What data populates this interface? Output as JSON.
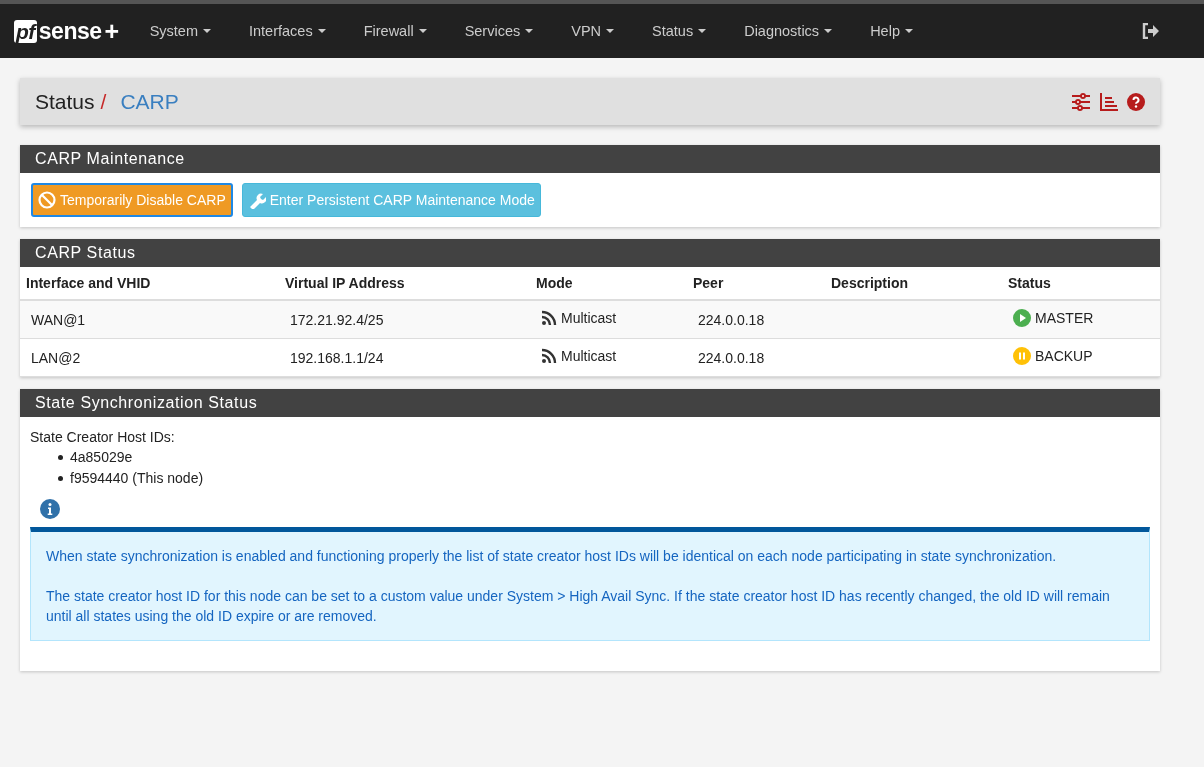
{
  "logo": {
    "box": "pf",
    "word": "sense",
    "plus": "+"
  },
  "nav": [
    {
      "label": "System"
    },
    {
      "label": "Interfaces"
    },
    {
      "label": "Firewall"
    },
    {
      "label": "Services"
    },
    {
      "label": "VPN"
    },
    {
      "label": "Status"
    },
    {
      "label": "Diagnostics"
    },
    {
      "label": "Help"
    }
  ],
  "breadcrumb": {
    "parent": "Status",
    "separator": "/",
    "current": "CARP"
  },
  "maintenance": {
    "title": "CARP Maintenance",
    "buttons": [
      {
        "kind": "disable",
        "label": "Temporarily Disable CARP"
      },
      {
        "kind": "persistent",
        "label": "Enter Persistent CARP Maintenance Mode"
      }
    ]
  },
  "carp_status": {
    "title": "CARP Status",
    "columns": [
      "Interface and VHID",
      "Virtual IP Address",
      "Mode",
      "Peer",
      "Description",
      "Status"
    ],
    "rows": [
      {
        "interface": "WAN@1",
        "vip": "172.21.92.4/25",
        "mode": "Multicast",
        "peer": "224.0.0.18",
        "status": {
          "kind": "master",
          "label": "MASTER"
        }
      },
      {
        "interface": "LAN@2",
        "vip": "192.168.1.1/24",
        "mode": "Multicast",
        "peer": "224.0.0.18",
        "status": {
          "kind": "backup",
          "label": "BACKUP"
        }
      }
    ]
  },
  "sync": {
    "title": "State Synchronization Status",
    "label": "State Creator Host IDs:",
    "ids": [
      "4a85029e",
      "f9594440 (This node)"
    ],
    "info": [
      "When state synchronization is enabled and functioning properly the list of state creator host IDs will be identical on each node participating in state synchronization.",
      "The state creator host ID for this node can be set to a custom value under System > High Avail Sync. If the state creator host ID has recently changed, the old ID will remain until all states using the old ID expire or are removed."
    ]
  }
}
